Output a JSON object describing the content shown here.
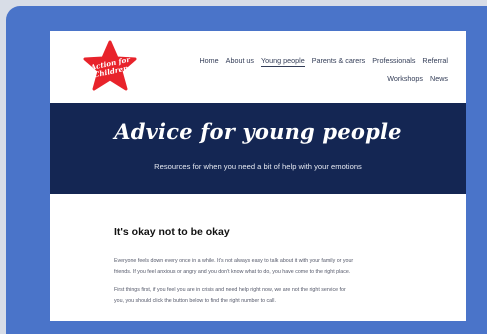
{
  "nav": {
    "row1": [
      "Home",
      "About us",
      "Young people",
      "Parents & carers",
      "Professionals",
      "Referral"
    ],
    "row2": [
      "Workshops",
      "News"
    ],
    "active": "Young people"
  },
  "logo": {
    "line1": "Action for",
    "line2": "Children",
    "color": "#e8232b"
  },
  "hero": {
    "title": "Advice for young people",
    "subtitle": "Resources for when you need a bit of help with your emotions",
    "background": "#142653"
  },
  "content": {
    "heading": "It's okay not to be okay",
    "para1_line1": "Everyone feels down every once in a while. It's not always easy to talk about it with your family or your",
    "para1_line2": "friends. If you feel anxious or angry and you don't know what to do, you have come to the right place.",
    "para2_line1": "First things first, if you feel you are in crisis and need help right now, we are not the right service for",
    "para2_line2": "you, you should click the button below to find the right number to call."
  },
  "colors": {
    "frame": "#4a74c9",
    "backdrop": "#d8dde7"
  }
}
